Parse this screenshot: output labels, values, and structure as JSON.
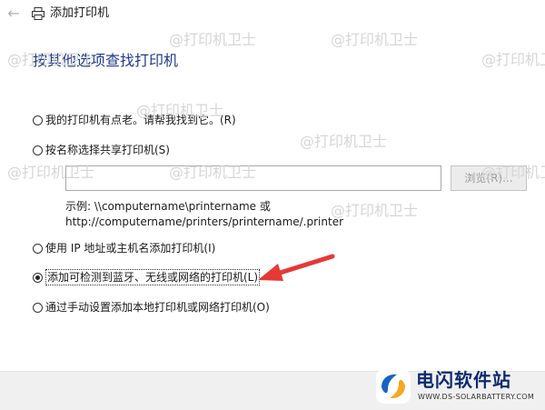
{
  "window": {
    "title": "添加打印机",
    "back_icon": "back-arrow-icon",
    "printer_icon": "printer-icon"
  },
  "heading": "按其他选项查找打印机",
  "options": [
    {
      "label": "我的打印机有点老。请帮我找到它。(R)",
      "checked": false
    },
    {
      "label": "按名称选择共享打印机(S)",
      "checked": false
    },
    {
      "label": "使用 IP 地址或主机名添加打印机(I)",
      "checked": false
    },
    {
      "label": "添加可检测到蓝牙、无线或网络的打印机(L)",
      "checked": true
    },
    {
      "label": "通过手动设置添加本地打印机或网络打印机(O)",
      "checked": false
    }
  ],
  "share": {
    "input_value": "",
    "browse_label": "浏览(R)...",
    "example_line1": "示例: \\\\computername\\printername 或",
    "example_line2": "http://computername/printers/printername/.printer"
  },
  "watermark": "@打印机卫士",
  "annotation": {
    "arrow_color": "#e53935"
  },
  "brand": {
    "name": "电闪软件站",
    "url": "WWW.DS-SOLARBATTERY.COM",
    "colors": {
      "blue": "#1565c0",
      "orange": "#f5a623",
      "navy": "#0b2a6f"
    }
  }
}
